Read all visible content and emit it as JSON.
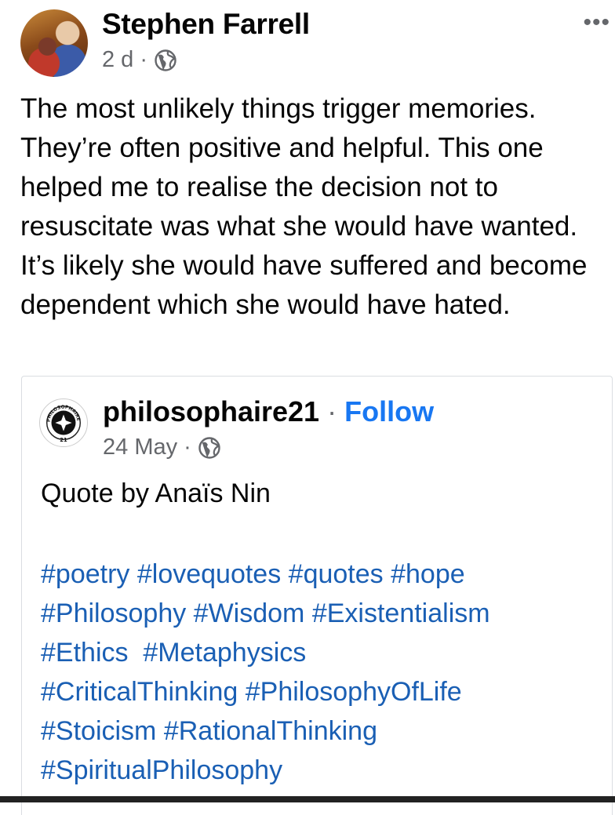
{
  "post": {
    "author": "Stephen Farrell",
    "time": "2 d",
    "separator": "·",
    "more_label": "•••",
    "text": "The most unlikely things trigger memories. They’re often positive and helpful. This one helped me to realise the decision not to resuscitate was what she would have wanted. It’s likely she would have suffered and become dependent which she would have hated."
  },
  "shared": {
    "page_name": "philosophaire21",
    "separator": "·",
    "follow_label": "Follow",
    "date": "24 May",
    "date_separator": "·",
    "logo_text": "PHILOSOPHAIRE",
    "logo_number": "21",
    "quote": "Quote by Anaïs Nin",
    "hashtags": [
      "#poetry #lovequotes #quotes #hope",
      "#Philosophy #Wisdom #Existentialism",
      "#Ethics  #Metaphysics",
      "#CriticalThinking #PhilosophyOfLife",
      "#Stoicism #RationalThinking",
      "#SpiritualPhilosophy"
    ]
  },
  "icons": {
    "audience": "globe-icon",
    "more": "more-options-icon",
    "logo": "page-logo-icon"
  },
  "colors": {
    "link_blue": "#1877f2",
    "hashtag_blue": "#1a5fb4",
    "meta_gray": "#65676b"
  }
}
